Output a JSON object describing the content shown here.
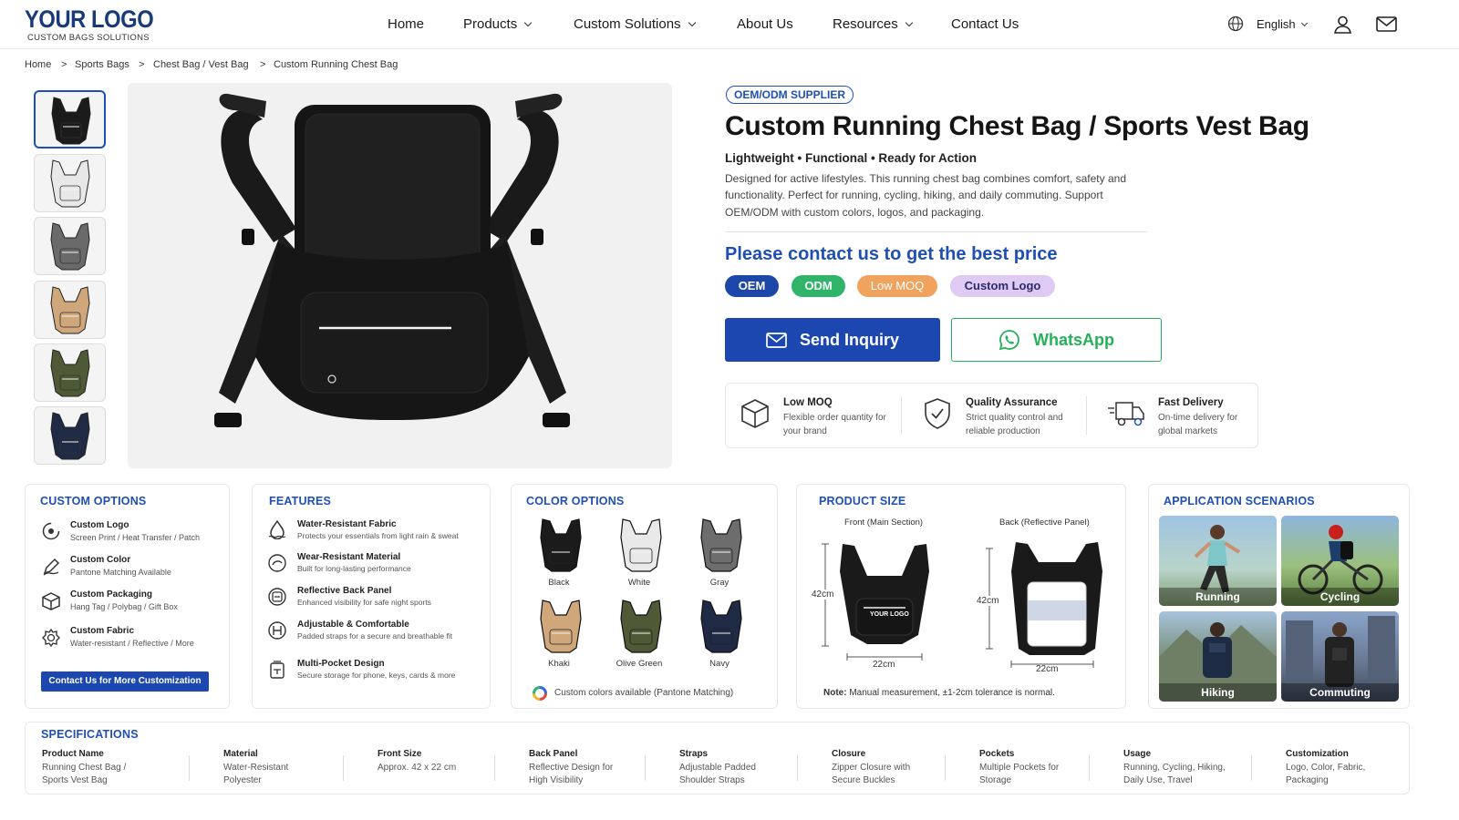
{
  "brand": {
    "logo": "YOUR LOGO",
    "tagline": "CUSTOM BAGS SOLUTIONS"
  },
  "nav": {
    "items": [
      "Home",
      "Products",
      "Custom Solutions",
      "About Us",
      "Resources",
      "Contact Us"
    ],
    "language": "English"
  },
  "breadcrumb": [
    "Home",
    "Sports Bags",
    "Chest Bag / Vest Bag",
    "Custom Running Chest Bag"
  ],
  "product": {
    "badge": "OEM/ODM SUPPLIER",
    "title": "Custom Running Chest Bag / Sports Vest Bag",
    "tagline": "Lightweight • Functional • Ready for Action",
    "description": "Designed for active lifestyles. This running chest bag combines comfort, safety and functionality. Perfect for running, cycling, hiking, and daily commuting. Support OEM/ODM with custom colors, logos, and packaging.",
    "price_cta": "Please contact us to get the best price",
    "tags": [
      "OEM",
      "ODM",
      "Low MOQ",
      "Custom Logo"
    ],
    "inquiry_label": "Send Inquiry",
    "whatsapp_label": "WhatsApp",
    "bag_logo": "YOUR LOGO",
    "thumbnail_colors": [
      "#1b1b1b",
      "#e8e8e8",
      "#6a6a6a",
      "#cfa77a",
      "#4e5a35",
      "#1f2a45"
    ],
    "highlights": [
      {
        "icon": "box-icon",
        "title": "Low MOQ",
        "desc": "Flexible order quantity for your brand"
      },
      {
        "icon": "shield-check-icon",
        "title": "Quality Assurance",
        "desc": "Strict quality control and reliable production"
      },
      {
        "icon": "truck-icon",
        "title": "Fast Delivery",
        "desc": "On-time delivery for global markets"
      }
    ]
  },
  "custom_options": {
    "title": "CUSTOM OPTIONS",
    "items": [
      {
        "icon": "logo-icon",
        "title": "Custom Logo",
        "desc": "Screen Print / Heat Transfer / Patch"
      },
      {
        "icon": "pen-icon",
        "title": "Custom Color",
        "desc": "Pantone Matching Available"
      },
      {
        "icon": "package-icon",
        "title": "Custom Packaging",
        "desc": "Hang Tag / Polybag / Gift Box"
      },
      {
        "icon": "fabric-icon",
        "title": "Custom Fabric",
        "desc": "Water-resistant / Reflective / More"
      }
    ],
    "button": "Contact Us for More Customization"
  },
  "features": {
    "title": "FEATURES",
    "items": [
      {
        "icon": "water-drop-icon",
        "title": "Water-Resistant Fabric",
        "desc": "Protects your essentials from light rain & sweat"
      },
      {
        "icon": "shield-icon",
        "title": "Wear-Resistant Material",
        "desc": "Built for long-lasting performance"
      },
      {
        "icon": "reflective-icon",
        "title": "Reflective Back Panel",
        "desc": "Enhanced visibility for safe night sports"
      },
      {
        "icon": "strap-icon",
        "title": "Adjustable & Comfortable",
        "desc": "Padded straps for a secure and breathable fit"
      },
      {
        "icon": "pocket-icon",
        "title": "Multi-Pocket Design",
        "desc": "Secure storage for phone, keys, cards & more"
      }
    ]
  },
  "color_options": {
    "title": "COLOR OPTIONS",
    "swatches": [
      {
        "name": "Black",
        "color": "#1b1b1b"
      },
      {
        "name": "White",
        "color": "#e9e9e9"
      },
      {
        "name": "Gray",
        "color": "#6d6d6d"
      },
      {
        "name": "Khaki",
        "color": "#cfa77a"
      },
      {
        "name": "Olive Green",
        "color": "#4e5a35"
      },
      {
        "name": "Navy",
        "color": "#1f2a45"
      }
    ],
    "note": "Custom colors available (Pantone Matching)"
  },
  "product_size": {
    "title": "PRODUCT SIZE",
    "front_label": "Front (Main Section)",
    "back_label": "Back (Reflective Panel)",
    "front_height": "42cm",
    "front_width": "22cm",
    "back_height": "42cm",
    "back_width": "22cm",
    "note_label": "Note:",
    "note": "Manual measurement, ±1-2cm tolerance is normal."
  },
  "scenarios": {
    "title": "APPLICATION SCENARIOS",
    "items": [
      "Running",
      "Cycling",
      "Hiking",
      "Commuting"
    ]
  },
  "specifications": {
    "title": "SPECIFICATIONS",
    "items": [
      {
        "label": "Product Name",
        "value": "Running Chest Bag / Sports Vest Bag"
      },
      {
        "label": "Material",
        "value": "Water-Resistant Polyester"
      },
      {
        "label": "Front Size",
        "value": "Approx. 42 x 22 cm"
      },
      {
        "label": "Back Panel",
        "value": "Reflective Design for High Visibility"
      },
      {
        "label": "Straps",
        "value": "Adjustable Padded Shoulder Straps"
      },
      {
        "label": "Closure",
        "value": "Zipper Closure with Secure Buckles"
      },
      {
        "label": "Pockets",
        "value": "Multiple Pockets for Storage"
      },
      {
        "label": "Usage",
        "value": "Running, Cycling, Hiking, Daily Use, Travel"
      },
      {
        "label": "Customization",
        "value": "Logo, Color, Fabric, Packaging"
      }
    ]
  },
  "colors": {
    "accent": "#1f4fb3",
    "oem": "#1c47a8",
    "odm": "#2fb46a",
    "moq": "#f0a35e",
    "logo_tag": "#d9c4f0",
    "whatsapp": "#25b158"
  }
}
